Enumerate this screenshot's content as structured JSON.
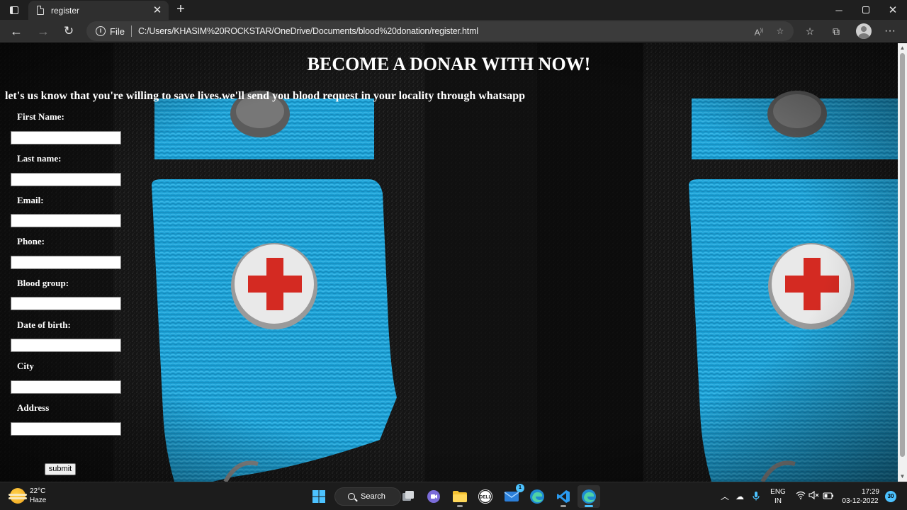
{
  "browser": {
    "tab_title": "register",
    "protocol_label": "File",
    "url": "C:/Users/KHASIM%20ROCKSTAR/OneDrive/Documents/blood%20donation/register.html"
  },
  "page": {
    "heading": "BECOME A DONAR WITH NOW!",
    "subtitle": "let's us know that you're willing to save lives.we'll send you blood request in your locality through whatsapp",
    "fields": [
      {
        "label": "First Name:",
        "value": ""
      },
      {
        "label": "Last name:",
        "value": ""
      },
      {
        "label": "Email:",
        "value": ""
      },
      {
        "label": "Phone:",
        "value": ""
      },
      {
        "label": "Blood group:",
        "value": ""
      },
      {
        "label": "Date of birth:",
        "value": ""
      },
      {
        "label": "City",
        "value": ""
      },
      {
        "label": "Address",
        "value": ""
      }
    ],
    "submit_label": "submit"
  },
  "taskbar": {
    "weather_temp": "22°C",
    "weather_desc": "Haze",
    "search_label": "Search",
    "mail_badge": "1",
    "lang_top": "ENG",
    "lang_bottom": "IN",
    "time": "17:29",
    "date": "03-12-2022",
    "notification_count": "30"
  },
  "colors": {
    "ribbon_blue": "#1aa3d6",
    "cross_red": "#d42a22",
    "taskbar_accent": "#4cc2ff"
  }
}
